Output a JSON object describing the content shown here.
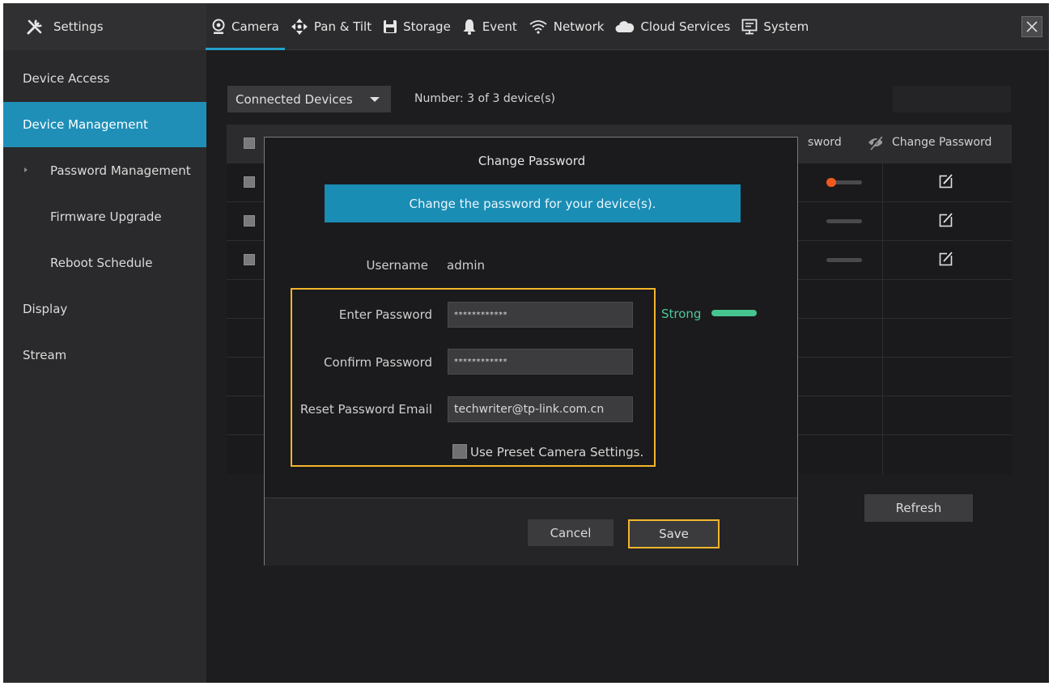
{
  "header": {
    "settings_label": "Settings",
    "tabs": [
      {
        "label": "Camera",
        "icon": "camera-pin-icon",
        "active": true
      },
      {
        "label": "Pan & Tilt",
        "icon": "pan-tilt-icon"
      },
      {
        "label": "Storage",
        "icon": "storage-icon"
      },
      {
        "label": "Event",
        "icon": "bell-icon"
      },
      {
        "label": "Network",
        "icon": "wifi-icon"
      },
      {
        "label": "Cloud Services",
        "icon": "cloud-icon"
      },
      {
        "label": "System",
        "icon": "monitor-icon"
      }
    ],
    "accent_color": "#23a0c7"
  },
  "sidebar": {
    "items": [
      {
        "label": "Device Access"
      },
      {
        "label": "Device Management",
        "active": true
      },
      {
        "label": "Password Management",
        "selected_sub": true
      },
      {
        "label": "Firmware Upgrade"
      },
      {
        "label": "Reboot Schedule"
      },
      {
        "label": "Display"
      },
      {
        "label": "Stream"
      }
    ],
    "active_color": "#1f8fb8"
  },
  "main": {
    "filter_value": "Connected Devices",
    "count_text": "Number: 3 of 3 device(s)",
    "table": {
      "headers": {
        "password": "sword",
        "change_password": "Change Password"
      },
      "rows": [
        {
          "password_visible": true
        },
        {
          "password_visible": false
        },
        {
          "password_visible": false
        }
      ]
    },
    "refresh_label": "Refresh"
  },
  "dialog": {
    "title": "Change Password",
    "banner": "Change the password for your device(s).",
    "username_label": "Username",
    "username_value": "admin",
    "enter_password_label": "Enter Password",
    "enter_password_value": "************",
    "confirm_password_label": "Confirm Password",
    "confirm_password_value": "************",
    "email_label": "Reset Password Email",
    "email_value": "techwriter@tp-link.com.cn",
    "strength_label": "Strong",
    "strength_color": "#45c48f",
    "preset_label": "Use Preset Camera Settings.",
    "preset_checked": false,
    "cancel_label": "Cancel",
    "save_label": "Save",
    "highlight_color": "#f3b52b"
  }
}
